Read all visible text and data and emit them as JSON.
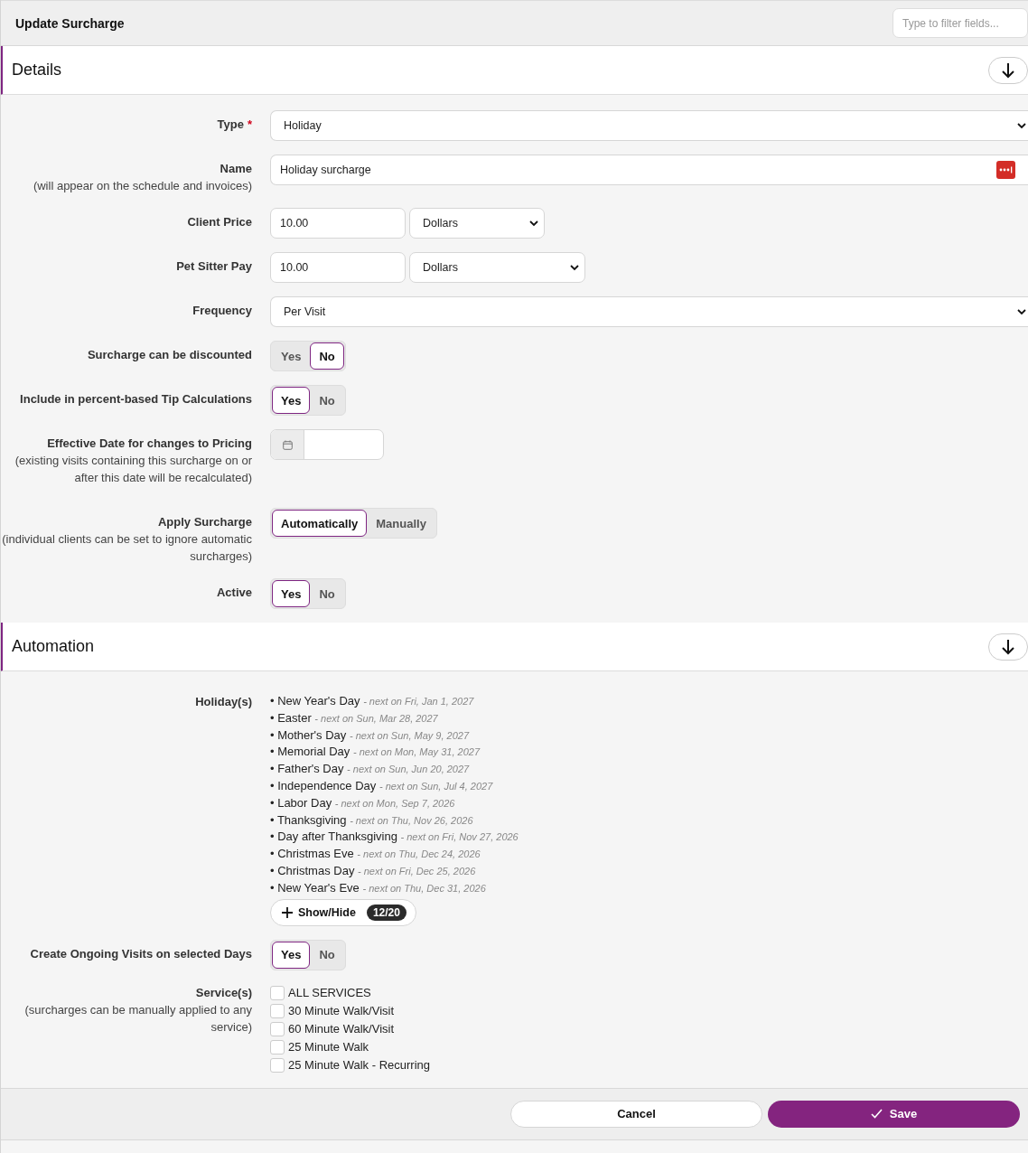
{
  "header": {
    "title": "Update Surcharge",
    "filter_placeholder": "Type to filter fields..."
  },
  "sections": [
    {
      "title": "Details",
      "fields": [
        {
          "kind": "select",
          "label": "Type",
          "required_mark": "*",
          "value": "Holiday"
        },
        {
          "kind": "text",
          "label": "Name",
          "hint": "(will appear on the schedule and invoices)",
          "value": "Holiday surcharge"
        },
        {
          "kind": "amount",
          "label": "Client Price",
          "value": "10.00",
          "unit": "Dollars"
        },
        {
          "kind": "amount",
          "label": "Pet Sitter Pay",
          "value": "10.00",
          "unit": "Dollars"
        },
        {
          "kind": "select",
          "label": "Frequency",
          "value": "Per Visit"
        },
        {
          "kind": "toggle",
          "label": "Surcharge can be discounted",
          "options": [
            {
              "label": "Yes",
              "selected": false
            },
            {
              "label": "No",
              "selected": true
            }
          ]
        },
        {
          "kind": "toggle",
          "label": "Include in percent-based Tip Calculations",
          "options": [
            {
              "label": "Yes",
              "selected": true
            },
            {
              "label": "No",
              "selected": false
            }
          ]
        },
        {
          "kind": "date",
          "label": "Effective Date for changes to Pricing",
          "hint": "(existing visits containing this surcharge on or after this date will be recalculated)"
        },
        {
          "kind": "toggle",
          "label": "Apply Surcharge",
          "hint": "(individual clients can be set to ignore automatic surcharges)",
          "options": [
            {
              "label": "Automatically",
              "selected": true
            },
            {
              "label": "Manually",
              "selected": false
            }
          ]
        },
        {
          "kind": "toggle",
          "label": "Active",
          "options": [
            {
              "label": "Yes",
              "selected": true
            },
            {
              "label": "No",
              "selected": false
            }
          ]
        }
      ]
    },
    {
      "title": "Automation",
      "fields": [
        {
          "kind": "holidays",
          "label": "Holiday(s)",
          "bullet": "•",
          "items": [
            {
              "name": "New Year's Day",
              "next": "- next on Fri, Jan 1, 2027"
            },
            {
              "name": "Easter",
              "next": "- next on Sun, Mar 28, 2027"
            },
            {
              "name": "Mother's Day",
              "next": "- next on Sun, May 9, 2027"
            },
            {
              "name": "Memorial Day",
              "next": "- next on Mon, May 31, 2027"
            },
            {
              "name": "Father's Day",
              "next": "- next on Sun, Jun 20, 2027"
            },
            {
              "name": "Independence Day",
              "next": "- next on Sun, Jul 4, 2027"
            },
            {
              "name": "Labor Day",
              "next": "- next on Mon, Sep 7, 2026"
            },
            {
              "name": "Thanksgiving",
              "next": "- next on Thu, Nov 26, 2026"
            },
            {
              "name": "Day after Thanksgiving",
              "next": "- next on Fri, Nov 27, 2026"
            },
            {
              "name": "Christmas Eve",
              "next": "- next on Thu, Dec 24, 2026"
            },
            {
              "name": "Christmas Day",
              "next": "- next on Fri, Dec 25, 2026"
            },
            {
              "name": "New Year's Eve",
              "next": "- next on Thu, Dec 31, 2026"
            }
          ],
          "toggle_button": "Show/Hide",
          "count": "12/20"
        },
        {
          "kind": "toggle",
          "label": "Create Ongoing Visits on selected Days",
          "options": [
            {
              "label": "Yes",
              "selected": true
            },
            {
              "label": "No",
              "selected": false
            }
          ]
        },
        {
          "kind": "checklist",
          "label": "Service(s)",
          "hint": "(surcharges can be manually applied to any service)",
          "items": [
            {
              "label": "ALL SERVICES",
              "checked": false
            },
            {
              "label": "30 Minute Walk/Visit",
              "checked": false
            },
            {
              "label": "60 Minute Walk/Visit",
              "checked": false
            },
            {
              "label": "25 Minute Walk",
              "checked": false
            },
            {
              "label": "25 Minute Walk - Recurring",
              "checked": false
            }
          ]
        }
      ]
    }
  ],
  "footer": {
    "cancel": "Cancel",
    "save": "Save"
  }
}
